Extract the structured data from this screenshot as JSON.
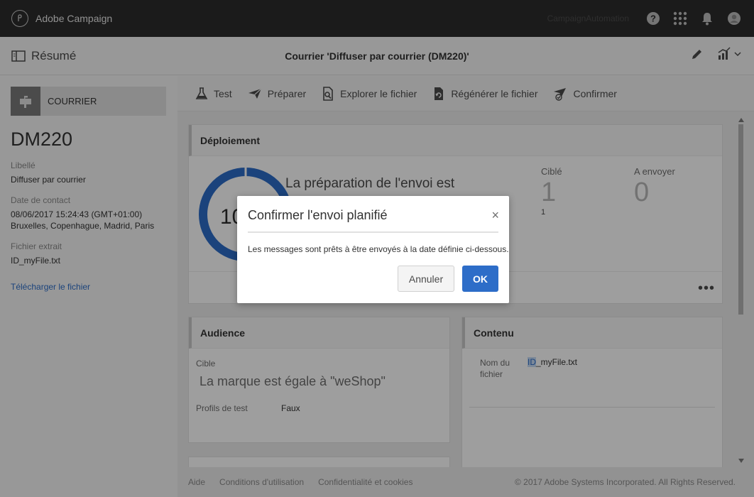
{
  "app": {
    "title": "Adobe Campaign",
    "user_name": "CampaignAutomation"
  },
  "subheader": {
    "summary_label": "Résumé",
    "delivery_title": "Courrier 'Diffuser par courrier (DM220)'"
  },
  "left_panel": {
    "channel": "COURRIER",
    "code": "DM220",
    "label_title": "Libellé",
    "label_value": "Diffuser par courrier",
    "contact_date_title": "Date de contact",
    "contact_date_value": "08/06/2017 15:24:43 (GMT+01:00)",
    "contact_date_tz": "Bruxelles, Copenhague, Madrid, Paris",
    "extract_file_title": "Fichier extrait",
    "extract_file_value": "ID_myFile.txt",
    "download_link": "Télécharger le fichier"
  },
  "actions": [
    {
      "label": "Test",
      "icon": "flask-icon"
    },
    {
      "label": "Préparer",
      "icon": "paper-plane-icon"
    },
    {
      "label": "Explorer le fichier",
      "icon": "file-search-icon"
    },
    {
      "label": "Régénérer le fichier",
      "icon": "file-refresh-icon"
    },
    {
      "label": "Confirmer",
      "icon": "confirm-send-icon"
    }
  ],
  "deployment": {
    "title": "Déploiement",
    "progress_percent": 100,
    "progress_display": "10",
    "status_text": "La préparation de l'envoi est",
    "targeted_label": "Ciblé",
    "targeted_value": "1",
    "targeted_sub": "1",
    "to_send_label": "A envoyer",
    "to_send_value": "0",
    "more": "•••"
  },
  "audience": {
    "title": "Audience",
    "target_label": "Cible",
    "target_value": "La marque est égale à \"weShop\"",
    "test_profiles_label": "Profils de test",
    "test_profiles_value": "Faux"
  },
  "content": {
    "title": "Contenu",
    "file_name_label": "Nom du fichier",
    "file_name_prefix": "ID",
    "file_name_rest": "_myFile.txt"
  },
  "footer": {
    "help": "Aide",
    "terms": "Conditions d'utilisation",
    "privacy": "Confidentialité et cookies",
    "copyright": "© 2017 Adobe Systems Incorporated. All Rights Reserved."
  },
  "dialog": {
    "title": "Confirmer l'envoi planifié",
    "close": "×",
    "message": "Les messages sont prêts à être envoyés à la date définie ci-dessous.",
    "cancel_label": "Annuler",
    "ok_label": "OK"
  },
  "colors": {
    "topbar": "#2d2d2d",
    "accent": "#2d6dc8",
    "donut": "#2d6dc8"
  }
}
